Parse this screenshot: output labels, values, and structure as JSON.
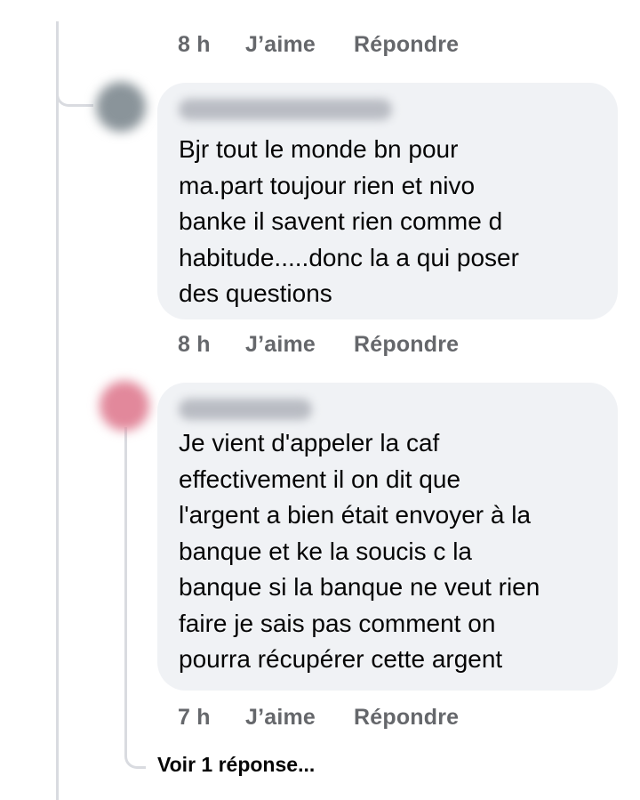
{
  "top_actions": {
    "time": "8 h",
    "like": "J’aime",
    "reply": "Répondre"
  },
  "comments": [
    {
      "author": "",
      "text": "Bjr tout le monde bn pour\nma.part toujour rien et nivo\nbanke il savent rien comme d\nhabitude.....donc la a qui poser\ndes questions",
      "time": "8 h",
      "like": "J’aime",
      "reply": "Répondre",
      "avatar_color": "#8a949a"
    },
    {
      "author": "",
      "text": "Je vient d'appeler la caf\neffectivement il on dit que\nl'argent a bien était envoyer à la\nbanque et ke la soucis c la\nbanque si la banque ne veut rien\nfaire je sais pas comment on\npourra récupérer cette argent",
      "time": "7 h",
      "like": "J’aime",
      "reply": "Répondre",
      "avatar_color": "#e2889b"
    }
  ],
  "see_replies": "Voir 1 réponse...",
  "colors": {
    "bubble": "#f0f2f5",
    "meta": "#65676b",
    "line": "#d9dbe0"
  }
}
